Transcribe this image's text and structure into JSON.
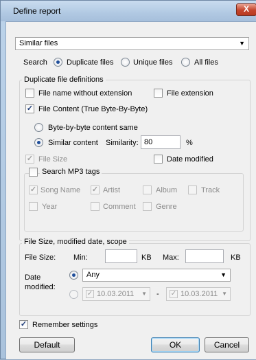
{
  "window": {
    "title": "Define report",
    "close_glyph": "X"
  },
  "report_type": {
    "selected": "Similar files"
  },
  "search": {
    "label": "Search",
    "options": [
      "Duplicate files",
      "Unique files",
      "All files"
    ],
    "selected": "Duplicate files"
  },
  "duplicate_definitions": {
    "title": "Duplicate file definitions",
    "file_name_without_extension": {
      "label": "File name without extension",
      "checked": false
    },
    "file_extension": {
      "label": "File extension",
      "checked": false
    },
    "file_content": {
      "label": "File Content (True Byte-By-Byte)",
      "checked": true
    },
    "byte_content_same": {
      "label": "Byte-by-byte content same",
      "selected": false
    },
    "similar_content": {
      "label": "Similar content",
      "selected": true
    },
    "similarity": {
      "label": "Similarity:",
      "value": "80",
      "unit": "%"
    },
    "file_size": {
      "label": "File Size",
      "checked": true,
      "enabled": false
    },
    "date_modified": {
      "label": "Date modified",
      "checked": false
    },
    "mp3": {
      "title": "Search MP3 tags",
      "checked": false,
      "tags": [
        {
          "label": "Song Name",
          "checked": true
        },
        {
          "label": "Artist",
          "checked": true
        },
        {
          "label": "Album",
          "checked": false
        },
        {
          "label": "Track",
          "checked": false
        },
        {
          "label": "Year",
          "checked": false
        },
        {
          "label": "Comment",
          "checked": false
        },
        {
          "label": "Genre",
          "checked": false
        }
      ]
    }
  },
  "size_scope": {
    "title": "File Size, modified date, scope",
    "file_size_label": "File Size:",
    "min_label": "Min:",
    "min_value": "",
    "min_unit": "KB",
    "max_label": "Max:",
    "max_value": "",
    "max_unit": "KB",
    "date_label_1": "Date",
    "date_label_2": "modified:",
    "date_any": "Any",
    "date_from": "10.03.2011",
    "date_dash": "-",
    "date_to": "10.03.2011"
  },
  "remember": {
    "label": "Remember settings",
    "checked": true
  },
  "buttons": {
    "default": "Default",
    "ok": "OK",
    "cancel": "Cancel"
  },
  "colors": {
    "accent": "#1f4e9a",
    "close": "#c4452c",
    "disabled_text": "#8c8c8c"
  }
}
